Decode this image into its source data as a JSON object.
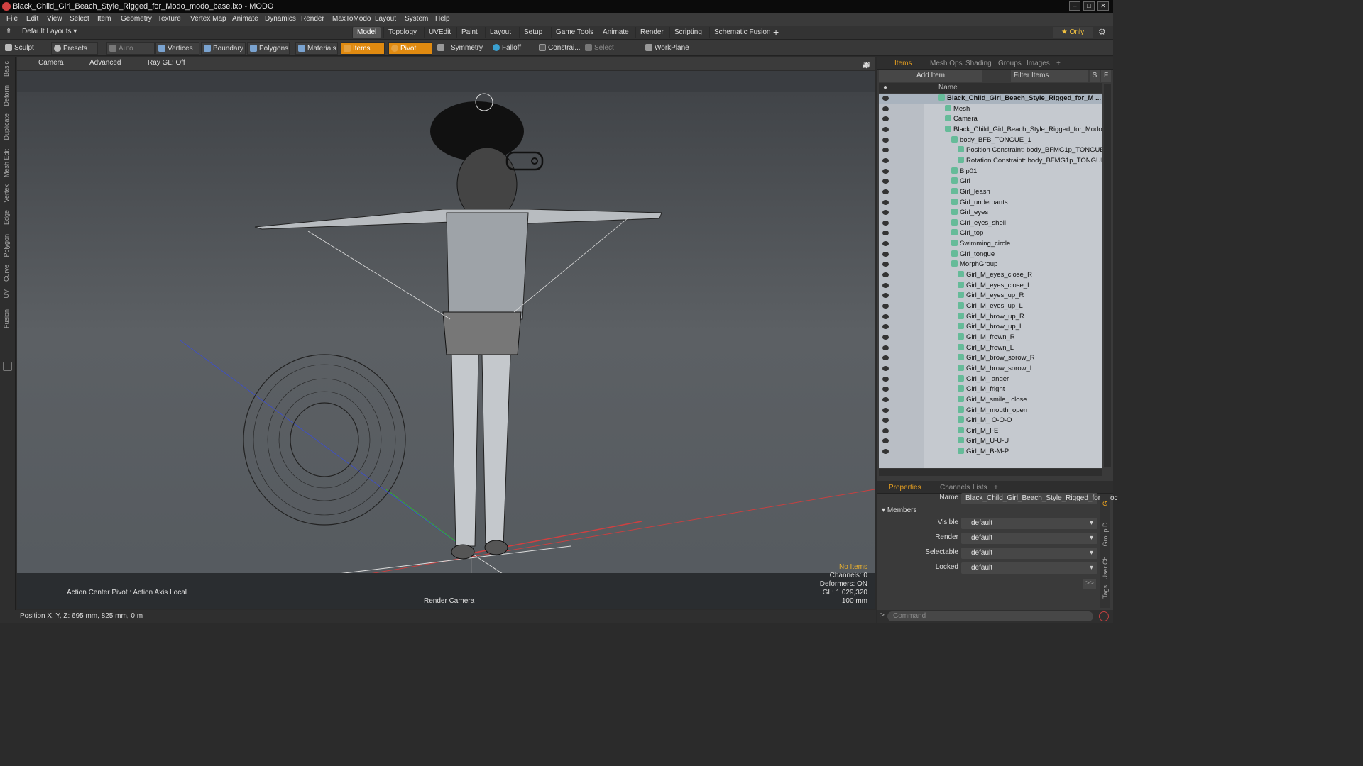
{
  "window": {
    "title": "Black_Child_Girl_Beach_Style_Rigged_for_Modo_modo_base.lxo - MODO",
    "controls": [
      "–",
      "□",
      "✕"
    ]
  },
  "menu": [
    "File",
    "Edit",
    "View",
    "Select",
    "Item",
    "Geometry",
    "Texture",
    "Vertex Map",
    "Animate",
    "Dynamics",
    "Render",
    "MaxToModo",
    "Layout",
    "System",
    "Help"
  ],
  "layouts": {
    "label": "Default Layouts ▾"
  },
  "modes": [
    "Model",
    "Topology",
    "UVEdit",
    "Paint",
    "Layout",
    "Setup",
    "Game Tools",
    "Animate",
    "Render",
    "Scripting",
    "Schematic Fusion"
  ],
  "active_mode": "Model",
  "only_label": "★  Only",
  "toolbar": [
    "Sculpt",
    "Presets",
    "Auto Select",
    "Vertices",
    "Boundary",
    "Polygons",
    "Materials",
    "Items",
    "Pivot",
    "Symmetry",
    "Falloff",
    "Constrai...",
    "Select Through",
    "WorkPlane"
  ],
  "left_tabs": [
    "Basic",
    "Deform",
    "Duplicate",
    "Mesh Edit",
    "Vertex",
    "Edge",
    "Polygon",
    "Curve",
    "UV",
    "Fusion"
  ],
  "viewport": {
    "bar": [
      "Camera",
      "Advanced",
      "Ray GL: Off"
    ],
    "action_center": "Action Center Pivot : Action Axis Local",
    "render_camera": "Render Camera",
    "stats": [
      "No Items",
      "Channels: 0",
      "Deformers: ON",
      "GL: 1,029,320",
      "100 mm"
    ]
  },
  "status": "Position X, Y, Z:   695 mm, 825 mm, 0 m",
  "items_panel": {
    "tabs": [
      "Items",
      "Mesh Ops",
      "Shading",
      "Groups",
      "Images",
      "+"
    ],
    "add_item": "Add Item",
    "filter": "Filter Items",
    "sf": [
      "S",
      "F"
    ],
    "col_name": "Name",
    "rows": [
      {
        "label": "Black_Child_Girl_Beach_Style_Rigged_for_M ...",
        "indent": 0
      },
      {
        "label": "Mesh",
        "indent": 1
      },
      {
        "label": "Camera",
        "indent": 1
      },
      {
        "label": "Black_Child_Girl_Beach_Style_Rigged_for_Modo (2)",
        "indent": 1
      },
      {
        "label": "body_BFB_TONGUE_1",
        "indent": 2
      },
      {
        "label": "Position Constraint: body_BFMG1p_TONGUE_1",
        "indent": 3
      },
      {
        "label": "Rotation Constraint: body_BFMG1p_TONGUE_1",
        "indent": 3
      },
      {
        "label": "Bip01",
        "indent": 2
      },
      {
        "label": "Girl",
        "indent": 2
      },
      {
        "label": "Girl_leash",
        "indent": 2
      },
      {
        "label": "Girl_underpants",
        "indent": 2
      },
      {
        "label": "Girl_eyes",
        "indent": 2
      },
      {
        "label": "Girl_eyes_shell",
        "indent": 2
      },
      {
        "label": "Girl_top",
        "indent": 2
      },
      {
        "label": "Swimming_circle",
        "indent": 2
      },
      {
        "label": "Girl_tongue",
        "indent": 2
      },
      {
        "label": "MorphGroup",
        "indent": 2
      },
      {
        "label": "Girl_M_eyes_close_R",
        "indent": 3
      },
      {
        "label": "Girl_M_eyes_close_L",
        "indent": 3
      },
      {
        "label": "Girl_M_eyes_up_R",
        "indent": 3
      },
      {
        "label": "Girl_M_eyes_up_L",
        "indent": 3
      },
      {
        "label": "Girl_M_brow_up_R",
        "indent": 3
      },
      {
        "label": "Girl_M_brow_up_L",
        "indent": 3
      },
      {
        "label": "Girl_M_frown_R",
        "indent": 3
      },
      {
        "label": "Girl_M_frown_L",
        "indent": 3
      },
      {
        "label": "Girl_M_brow_sorow_R",
        "indent": 3
      },
      {
        "label": "Girl_M_brow_sorow_L",
        "indent": 3
      },
      {
        "label": "Girl_M_ anger",
        "indent": 3
      },
      {
        "label": "Girl_M_fright",
        "indent": 3
      },
      {
        "label": "Girl_M_smile_ close",
        "indent": 3
      },
      {
        "label": "Girl_M_mouth_open",
        "indent": 3
      },
      {
        "label": "Girl_M_ O-O-O",
        "indent": 3
      },
      {
        "label": "Girl_M_I-E",
        "indent": 3
      },
      {
        "label": "Girl_M_U-U-U",
        "indent": 3
      },
      {
        "label": "Girl_M_B-M-P",
        "indent": 3
      }
    ]
  },
  "properties": {
    "tabs": [
      "Properties",
      "Channels",
      "Lists",
      "+"
    ],
    "name_label": "Name",
    "name_value": "Black_Child_Girl_Beach_Style_Rigged_for_Moc",
    "section": "Members",
    "fields": [
      {
        "label": "Visible",
        "value": "default"
      },
      {
        "label": "Render",
        "value": "default"
      },
      {
        "label": "Selectable",
        "value": "default"
      },
      {
        "label": "Locked",
        "value": "default"
      }
    ],
    "side_tabs": [
      "G...",
      "Group D...",
      "User Ch...",
      "Tags"
    ]
  },
  "command": {
    "placeholder": "Command"
  }
}
